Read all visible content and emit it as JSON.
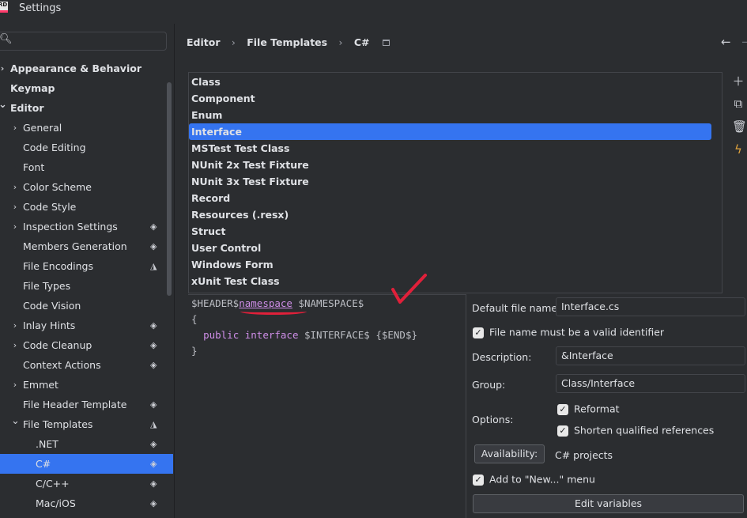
{
  "window": {
    "title": "Settings",
    "logo_text": "RD"
  },
  "search": {
    "icon": "search-icon",
    "value": ""
  },
  "tree": [
    {
      "label": "Appearance & Behavior",
      "indent": 0,
      "chevron": "right",
      "bold": true
    },
    {
      "label": "Keymap",
      "indent": 0,
      "chevron": "",
      "bold": true
    },
    {
      "label": "Editor",
      "indent": 0,
      "chevron": "down",
      "bold": true
    },
    {
      "label": "General",
      "indent": 1,
      "chevron": "right"
    },
    {
      "label": "Code Editing",
      "indent": 1,
      "chevron": ""
    },
    {
      "label": "Font",
      "indent": 1,
      "chevron": ""
    },
    {
      "label": "Color Scheme",
      "indent": 1,
      "chevron": "right"
    },
    {
      "label": "Code Style",
      "indent": 1,
      "chevron": "right"
    },
    {
      "label": "Inspection Settings",
      "indent": 1,
      "chevron": "right",
      "icon": "layers"
    },
    {
      "label": "Members Generation",
      "indent": 1,
      "chevron": "",
      "icon": "layers"
    },
    {
      "label": "File Encodings",
      "indent": 1,
      "chevron": "",
      "icon": "triangle-layers"
    },
    {
      "label": "File Types",
      "indent": 1,
      "chevron": ""
    },
    {
      "label": "Code Vision",
      "indent": 1,
      "chevron": ""
    },
    {
      "label": "Inlay Hints",
      "indent": 1,
      "chevron": "right",
      "icon": "layers"
    },
    {
      "label": "Code Cleanup",
      "indent": 1,
      "chevron": "right",
      "icon": "layers"
    },
    {
      "label": "Context Actions",
      "indent": 1,
      "chevron": "",
      "icon": "layers"
    },
    {
      "label": "Emmet",
      "indent": 1,
      "chevron": "right"
    },
    {
      "label": "File Header Template",
      "indent": 1,
      "chevron": "",
      "icon": "layers"
    },
    {
      "label": "File Templates",
      "indent": 1,
      "chevron": "down",
      "icon": "triangle-layers"
    },
    {
      "label": ".NET",
      "indent": 2,
      "chevron": "",
      "icon": "layers"
    },
    {
      "label": "C#",
      "indent": 2,
      "chevron": "",
      "icon": "layers",
      "selected": true
    },
    {
      "label": "C/C++",
      "indent": 2,
      "chevron": "",
      "icon": "layers"
    },
    {
      "label": "Mac/iOS",
      "indent": 2,
      "chevron": "",
      "icon": "layers"
    }
  ],
  "breadcrumb": {
    "items": [
      "Editor",
      "File Templates",
      "C#"
    ]
  },
  "templates": {
    "items": [
      "Class",
      "Component",
      "Enum",
      "Interface",
      "MSTest Test Class",
      "NUnit 2x Test Fixture",
      "NUnit 3x Test Fixture",
      "Record",
      "Resources (.resx)",
      "Struct",
      "User Control",
      "Windows Form",
      "xUnit Test Class"
    ],
    "selected": "Interface"
  },
  "toolbar_icons": [
    "add-icon",
    "copy-icon",
    "delete-icon",
    "bolt-icon"
  ],
  "editor": {
    "line1_a": "$HEADER$",
    "line1_kw": "namespace",
    "line1_b": " $NAMESPACE$",
    "line2": "{",
    "line3_indent": "  ",
    "line3_kw1": "public",
    "line3_kw2": "interface",
    "line3_rest": " $INTERFACE$ {$END$}",
    "line4": "}"
  },
  "form": {
    "default_file_name_label": "Default file name:",
    "default_file_name_value": "Interface.cs",
    "valid_identifier_label": "File name must be a valid identifier",
    "description_label": "Description:",
    "description_value": "&Interface",
    "group_label": "Group:",
    "group_value": "Class/Interface",
    "options_label": "Options:",
    "reformat_label": "Reformat",
    "shorten_label": "Shorten qualified references",
    "availability_button": "Availability:",
    "availability_value": "C# projects",
    "add_to_new_label": "Add to \"New...\" menu",
    "edit_variables_button": "Edit variables"
  },
  "colors": {
    "accent": "#3574f0",
    "keyword": "#cf8ee8",
    "annotation": "#e0203a"
  }
}
